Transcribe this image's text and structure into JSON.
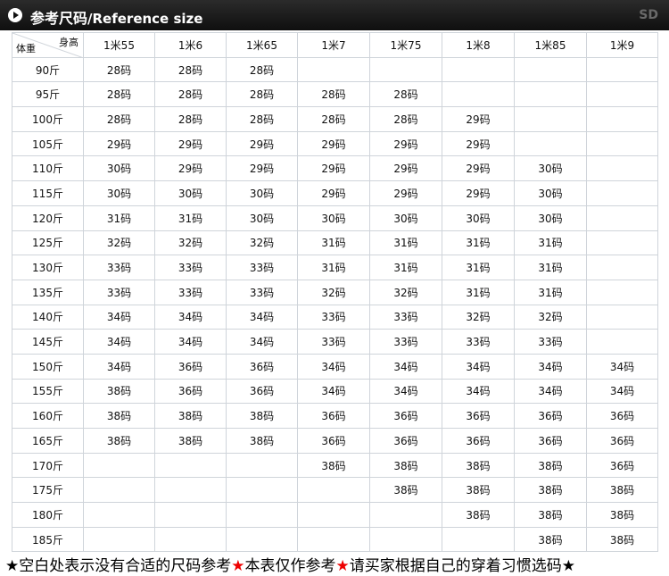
{
  "header": {
    "title": "参考尺码",
    "subtitle": "/Reference size",
    "brand": "SD"
  },
  "table": {
    "corner_height_label": "身高",
    "corner_weight_label": "体重",
    "columns": [
      "1米55",
      "1米6",
      "1米65",
      "1米7",
      "1米75",
      "1米8",
      "1米85",
      "1米9"
    ],
    "rows": [
      {
        "weight": "90斤",
        "values": [
          "28码",
          "28码",
          "28码",
          "",
          "",
          "",
          "",
          ""
        ]
      },
      {
        "weight": "95斤",
        "values": [
          "28码",
          "28码",
          "28码",
          "28码",
          "28码",
          "",
          "",
          ""
        ]
      },
      {
        "weight": "100斤",
        "values": [
          "28码",
          "28码",
          "28码",
          "28码",
          "28码",
          "29码",
          "",
          ""
        ]
      },
      {
        "weight": "105斤",
        "values": [
          "29码",
          "29码",
          "29码",
          "29码",
          "29码",
          "29码",
          "",
          ""
        ]
      },
      {
        "weight": "110斤",
        "values": [
          "30码",
          "29码",
          "29码",
          "29码",
          "29码",
          "29码",
          "30码",
          ""
        ]
      },
      {
        "weight": "115斤",
        "values": [
          "30码",
          "30码",
          "30码",
          "29码",
          "29码",
          "29码",
          "30码",
          ""
        ]
      },
      {
        "weight": "120斤",
        "values": [
          "31码",
          "31码",
          "30码",
          "30码",
          "30码",
          "30码",
          "30码",
          ""
        ]
      },
      {
        "weight": "125斤",
        "values": [
          "32码",
          "32码",
          "32码",
          "31码",
          "31码",
          "31码",
          "31码",
          ""
        ]
      },
      {
        "weight": "130斤",
        "values": [
          "33码",
          "33码",
          "33码",
          "31码",
          "31码",
          "31码",
          "31码",
          ""
        ]
      },
      {
        "weight": "135斤",
        "values": [
          "33码",
          "33码",
          "33码",
          "32码",
          "32码",
          "31码",
          "31码",
          ""
        ]
      },
      {
        "weight": "140斤",
        "values": [
          "34码",
          "34码",
          "34码",
          "33码",
          "33码",
          "32码",
          "32码",
          ""
        ]
      },
      {
        "weight": "145斤",
        "values": [
          "34码",
          "34码",
          "34码",
          "33码",
          "33码",
          "33码",
          "33码",
          ""
        ]
      },
      {
        "weight": "150斤",
        "values": [
          "34码",
          "36码",
          "36码",
          "34码",
          "34码",
          "34码",
          "34码",
          "34码"
        ]
      },
      {
        "weight": "155斤",
        "values": [
          "38码",
          "36码",
          "36码",
          "34码",
          "34码",
          "34码",
          "34码",
          "34码"
        ]
      },
      {
        "weight": "160斤",
        "values": [
          "38码",
          "38码",
          "38码",
          "36码",
          "36码",
          "36码",
          "36码",
          "36码"
        ]
      },
      {
        "weight": "165斤",
        "values": [
          "38码",
          "38码",
          "38码",
          "36码",
          "36码",
          "36码",
          "36码",
          "36码"
        ]
      },
      {
        "weight": "170斤",
        "values": [
          "",
          "",
          "",
          "38码",
          "38码",
          "38码",
          "38码",
          "36码"
        ]
      },
      {
        "weight": "175斤",
        "values": [
          "",
          "",
          "",
          "",
          "38码",
          "38码",
          "38码",
          "38码"
        ]
      },
      {
        "weight": "180斤",
        "values": [
          "",
          "",
          "",
          "",
          "",
          "38码",
          "38码",
          "38码"
        ]
      },
      {
        "weight": "185斤",
        "values": [
          "",
          "",
          "",
          "",
          "",
          "",
          "38码",
          "38码"
        ]
      }
    ]
  },
  "footer": {
    "star": "★",
    "part1": "空白处表示没有合适的尺码参考",
    "part2": "本表仅作参考",
    "part3": "请买家根据自己的穿着习惯选码",
    "colors": {
      "star_black": "#000000",
      "star_red": "#e00000"
    }
  }
}
